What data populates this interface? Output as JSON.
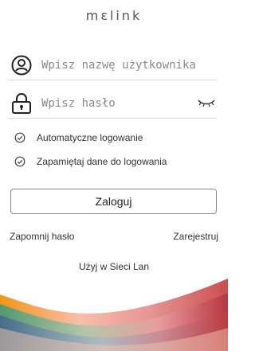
{
  "app": {
    "logo_text": "mɛlink"
  },
  "form": {
    "username_placeholder": "Wpisz nazwę użytkownika",
    "password_placeholder": "Wpisz hasło"
  },
  "options": {
    "auto_login": "Automatyczne logowanie",
    "remember": "Zapamiętaj dane do logowania"
  },
  "actions": {
    "login": "Zaloguj",
    "forgot": "Zapomnij hasło",
    "register": "Zarejestruj",
    "lan": "Użyj w Sieci Lan"
  },
  "icons": {
    "user": "user-circle-icon",
    "lock": "lock-icon",
    "eye": "eye-closed-icon",
    "check": "check-circle-icon"
  },
  "colors": {
    "text": "#333333",
    "border": "#888888",
    "divider": "#d7d7d7"
  }
}
